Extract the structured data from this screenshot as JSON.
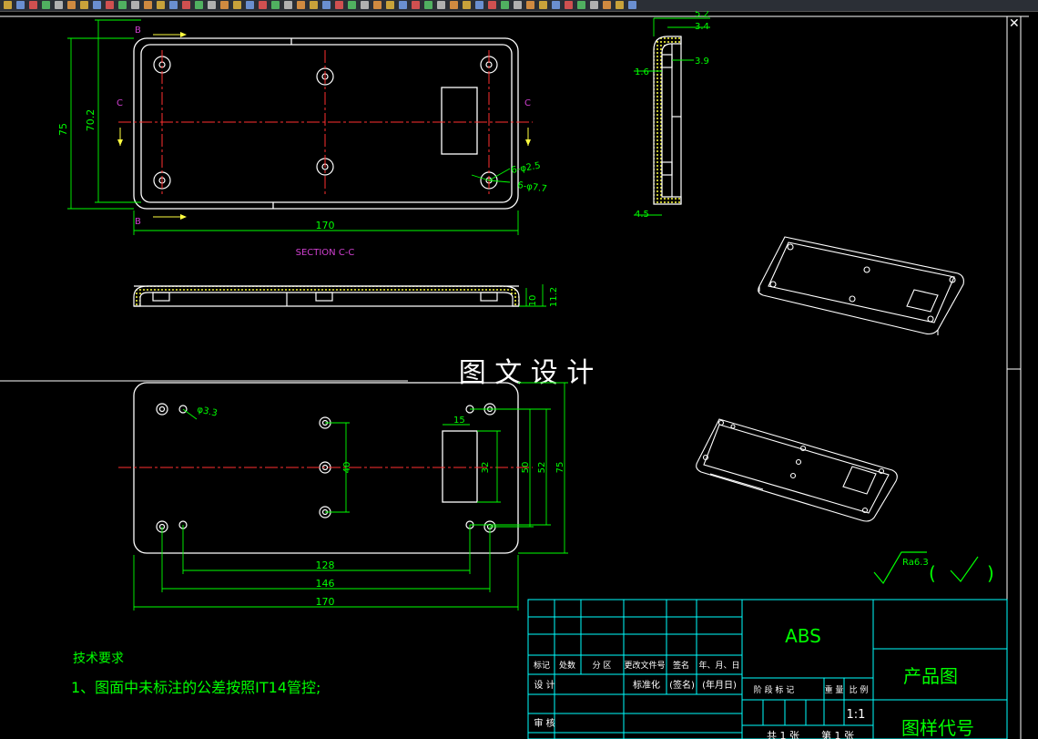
{
  "colors": {
    "background": "#000000",
    "outline": "#ffffff",
    "dimension": "#00ff00",
    "centerline": "#ff3030",
    "section_label": "#d040d0",
    "hatch": "#ffff40",
    "table_line": "#00ffff",
    "table_text": "#ffffff",
    "title_text": "#00ff00",
    "roughness": "#00ff00"
  },
  "toolbar": {
    "icons": [
      "app-icon",
      "tool-icon",
      "tool-icon",
      "tool-icon",
      "tool-icon",
      "tool-icon",
      "tool-icon",
      "tool-icon",
      "tool-icon",
      "tool-icon",
      "tool-icon",
      "tool-icon",
      "tool-icon",
      "tool-icon",
      "tool-icon",
      "tool-icon",
      "tool-icon",
      "tool-icon",
      "tool-icon",
      "tool-icon",
      "tool-icon",
      "tool-icon",
      "tool-icon",
      "tool-icon",
      "tool-icon",
      "tool-icon",
      "tool-icon",
      "tool-icon",
      "tool-icon",
      "tool-icon",
      "tool-icon",
      "tool-icon",
      "tool-icon",
      "tool-icon",
      "tool-icon",
      "tool-icon",
      "tool-icon",
      "tool-icon",
      "tool-icon",
      "tool-icon",
      "tool-icon",
      "tool-icon",
      "tool-icon",
      "tool-icon",
      "tool-icon",
      "tool-icon",
      "tool-icon",
      "tool-icon",
      "tool-icon",
      "tool-icon"
    ]
  },
  "front_view": {
    "section_b_top": "B",
    "section_b_bottom": "B",
    "section_c_left": "C",
    "section_c_right": "C",
    "dim_height_outer": "75",
    "dim_height_inner": "70.2",
    "dim_width": "170",
    "hole_small": "6-φ2.5",
    "hole_large": "6-φ7.7"
  },
  "side_view": {
    "dim_top1": "5.2",
    "dim_top2": "3.4",
    "dim_left": "1.6",
    "dim_right": "3.9",
    "dim_bottom": "4.5"
  },
  "section_view": {
    "title": "SECTION C-C",
    "dim_inner": "10",
    "dim_outer": "11.2"
  },
  "watermark": "图 文 设 计",
  "bottom_view": {
    "hole_dia": "φ3.3",
    "dim_15": "15",
    "dim_40": "40",
    "dim_32": "32",
    "dim_50": "50",
    "dim_52": "52",
    "dim_75": "75",
    "dim_128": "128",
    "dim_146": "146",
    "dim_170": "170"
  },
  "roughness": {
    "value": "Ra6.3",
    "open_paren": "(",
    "close_paren": ")"
  },
  "notes": {
    "heading": "技术要求",
    "line1": "1、图面中未标注的公差按照IT14管控;"
  },
  "title_block": {
    "material": "ABS",
    "product_name": "产品图",
    "drawing_code": "图样代号",
    "scale": "1:1",
    "rev_headers": [
      "标记",
      "处数",
      "分 区",
      "更改文件号",
      "签名",
      "年、月、日"
    ],
    "design": "设 计",
    "standardize": "标准化",
    "sign": "(签名)",
    "date": "(年月日)",
    "review": "审 核",
    "stage_headers": [
      "阶 段 标 记",
      "重 量",
      "比 例"
    ],
    "sheets_total": "共 1 张",
    "sheet_no": "第 1 张"
  }
}
